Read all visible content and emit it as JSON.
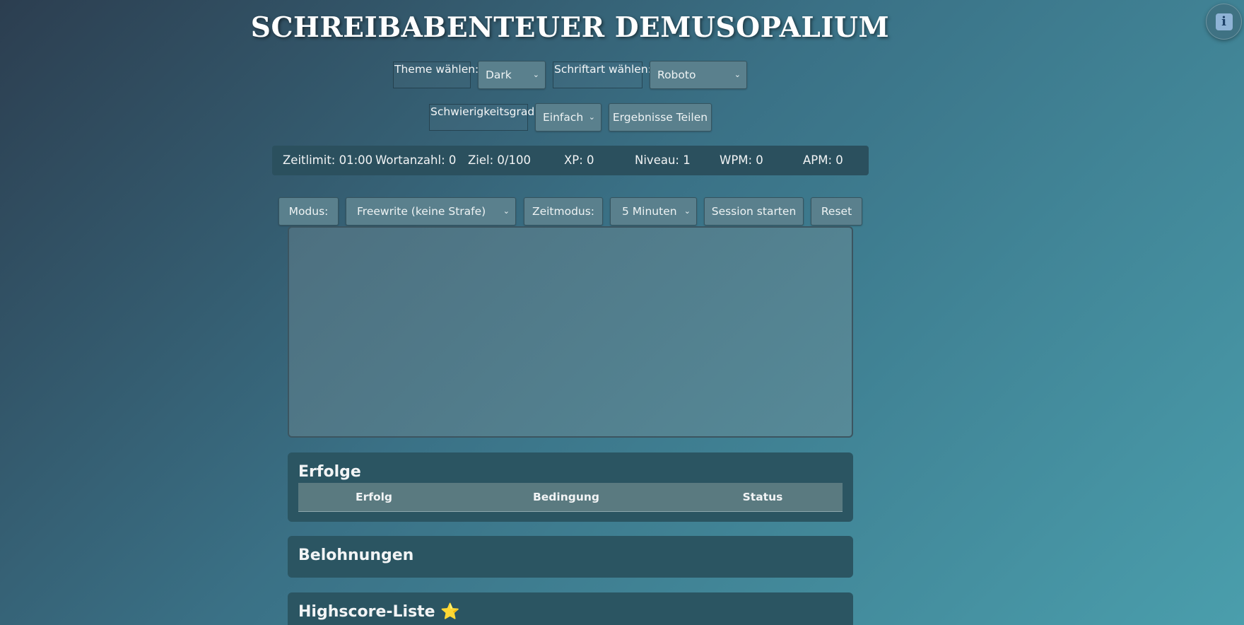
{
  "header": {
    "title": "SCHREIBABENTEUER DEMUSOPALIUM",
    "info_icon": "information-icon",
    "info_glyph": "i"
  },
  "settings": {
    "theme_label": "Theme wählen:",
    "theme_value": "Dark",
    "font_label": "Schriftart wählen:",
    "font_value": "Roboto",
    "difficulty_label": "Schwierigkeitsgrad:",
    "difficulty_value": "Einfach",
    "share_button": "Ergebnisse Teilen"
  },
  "stats": {
    "time_limit": "Zeitlimit: 01:00",
    "word_count": "Wortanzahl: 0",
    "goal": "Ziel: 0/100",
    "xp": "XP: 0",
    "level": "Niveau: 1",
    "wpm": "WPM: 0",
    "apm": "APM: 0"
  },
  "controls": {
    "mode_label": "Modus:",
    "mode_value": "Freewrite (keine Strafe)",
    "time_mode_label": "Zeitmodus:",
    "time_mode_value": "5 Minuten",
    "start_button": "Session starten",
    "reset_button": "Reset"
  },
  "editor": {
    "value": ""
  },
  "achievements": {
    "title": "Erfolge",
    "columns": [
      "Erfolg",
      "Bedingung",
      "Status"
    ]
  },
  "rewards": {
    "title": "Belohnungen"
  },
  "highscores": {
    "title": "Highscore-Liste",
    "title_emoji": "⭐"
  },
  "colors": {
    "background_start": "#2c3e50",
    "background_end": "#4a9eac",
    "panel": "#2b5562",
    "control": "#5a808d"
  }
}
